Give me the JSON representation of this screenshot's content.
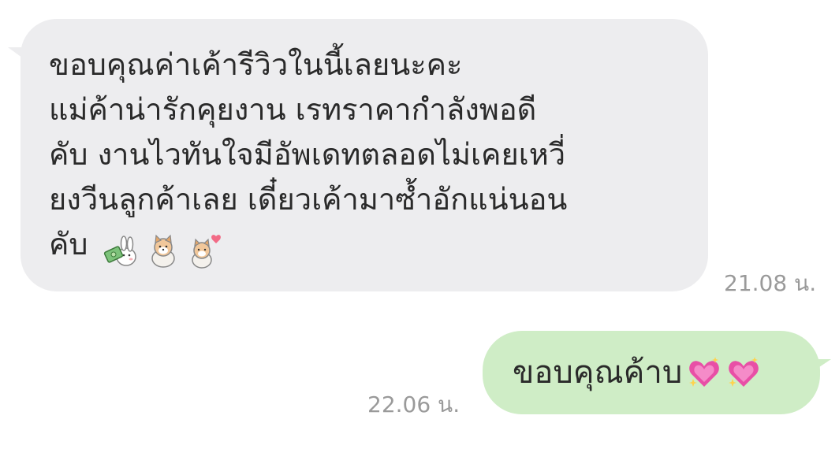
{
  "messages": {
    "incoming": {
      "text": "ขอบคุณค่าเค้ารีวิวในนี้เลยนะคะ\nแม่ค้าน่ารักคุยงาน เรทราคากำลังพอดี\nคับ งานไวทันใจมีอัพเดทตลอดไม่เคยเหวี่\nยงวีนลูกค้าเลย เดี๋ยวเค้ามาซ้ำอักแน่นอน\nคับ",
      "time": "21.08 น.",
      "stickers": [
        "rabbit-money-sticker",
        "shiba-dog-sticker",
        "shiba-heart-sticker"
      ]
    },
    "outgoing": {
      "text": "ขอบคุณค้าบ",
      "time": "22.06 น.",
      "emojis": [
        "sparkling-heart-icon",
        "sparkling-heart-icon"
      ]
    }
  },
  "colors": {
    "incoming_bubble": "#ededef",
    "outgoing_bubble": "#cfedc6",
    "text": "#2a2a2a",
    "timestamp": "#9a9a9a"
  }
}
